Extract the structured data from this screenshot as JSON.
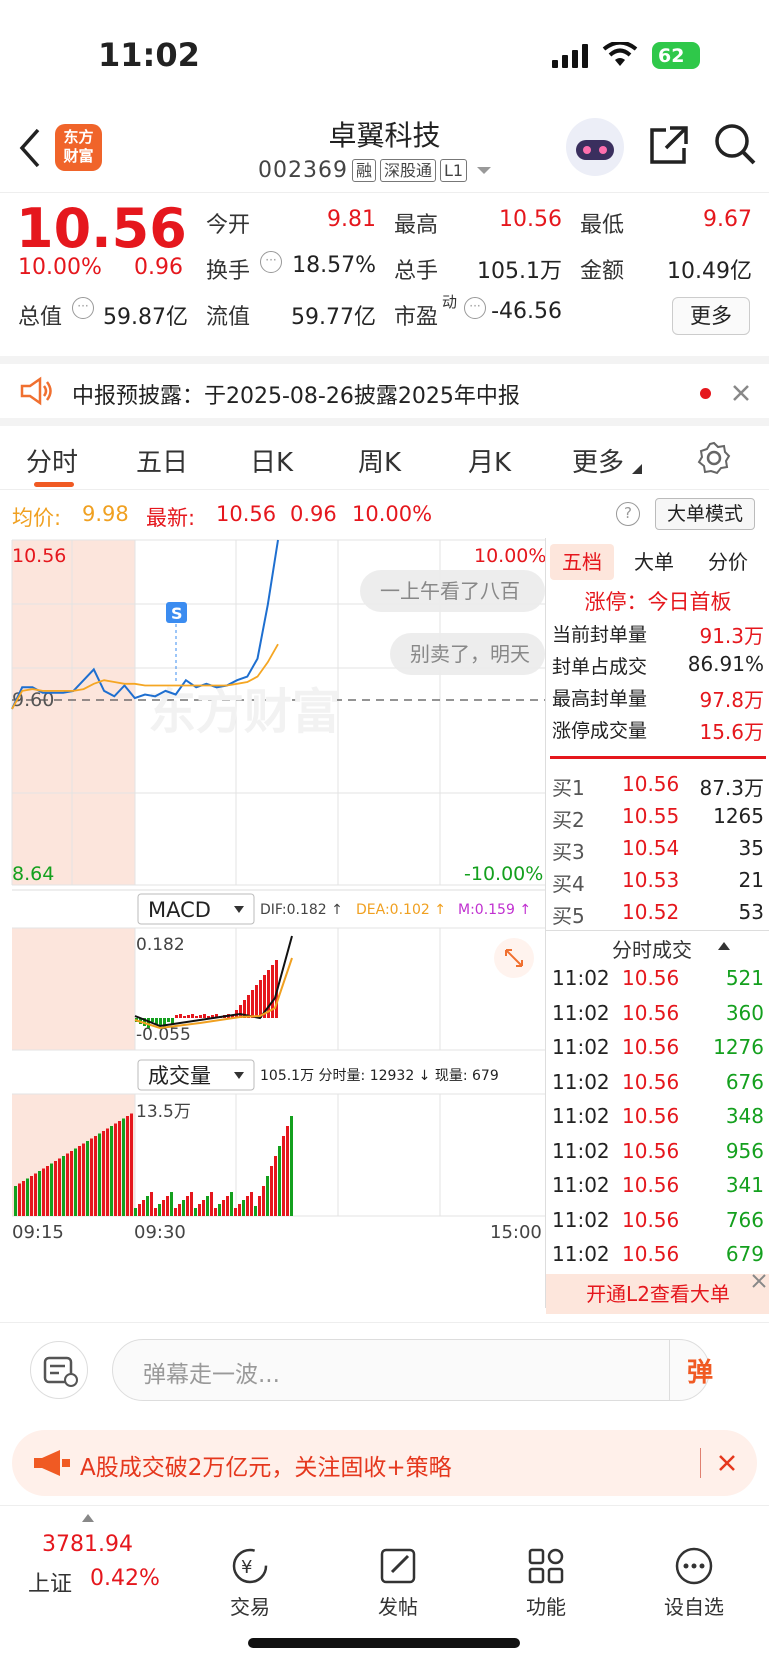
{
  "status": {
    "time": "11:02",
    "battery": "62"
  },
  "header": {
    "logo": "东方\n财富",
    "name": "卓翼科技",
    "code": "002369",
    "tags": [
      "融",
      "深股通",
      "L1"
    ]
  },
  "quote": {
    "price": "10.56",
    "change_pct": "10.00%",
    "change": "0.96",
    "open_label": "今开",
    "open": "9.81",
    "high_label": "最高",
    "high": "10.56",
    "low_label": "最低",
    "low": "9.67",
    "turnover_label": "换手",
    "turnover": "18.57%",
    "volume_label": "总手",
    "volume": "105.1万",
    "amount_label": "金额",
    "amount": "10.49亿",
    "mktcap_label": "总值",
    "mktcap": "59.87亿",
    "float_label": "流值",
    "float": "59.77亿",
    "pe_label": "市盈",
    "pe_sup": "动",
    "pe": "-46.56",
    "more": "更多"
  },
  "notice": {
    "text": "中报预披露：于2025-08-26披露2025年中报"
  },
  "tabs": [
    "分时",
    "五日",
    "日K",
    "周K",
    "月K",
    "更多"
  ],
  "info": {
    "avg_label": "均价:",
    "avg": "9.98",
    "latest_label": "最新:",
    "latest": "10.56",
    "chg": "0.96",
    "pct": "10.00%",
    "mode": "大单模式"
  },
  "chart_data": {
    "type": "line",
    "x": [
      "09:15",
      "09:30",
      "15:00"
    ],
    "y_left_top": "10.56",
    "y_left_mid": "9.60",
    "y_left_bottom": "8.64",
    "y_right_top": "10.00%",
    "y_right_bottom": "-10.00%",
    "ylim": [
      8.64,
      10.56
    ],
    "series": [
      {
        "name": "price",
        "color": "#1e6fd0",
        "values": [
          9.62,
          9.74,
          9.74,
          9.71,
          9.71,
          9.71,
          9.72,
          9.78,
          9.84,
          9.72,
          9.69,
          9.75,
          9.68,
          9.7,
          9.69,
          9.72,
          9.7,
          9.78,
          9.74,
          9.76,
          9.74,
          9.75,
          9.78,
          9.8,
          9.9,
          10.2,
          10.56
        ]
      },
      {
        "name": "avg",
        "color": "#f5a623",
        "values": [
          9.62,
          9.72,
          9.73,
          9.72,
          9.72,
          9.72,
          9.72,
          9.73,
          9.76,
          9.78,
          9.77,
          9.76,
          9.76,
          9.75,
          9.75,
          9.75,
          9.75,
          9.75,
          9.75,
          9.75,
          9.75,
          9.75,
          9.76,
          9.77,
          9.8,
          9.88,
          9.98
        ]
      }
    ],
    "danmaku": [
      "一上午看了八百",
      "别卖了，明天"
    ],
    "watermark": "东方财富",
    "s_marker": "S"
  },
  "macd": {
    "label": "MACD",
    "dif": "DIF:0.182 ↑",
    "dea": "DEA:0.102 ↑",
    "m": "M:0.159 ↑",
    "top": "0.182",
    "bottom": "-0.055"
  },
  "vol": {
    "label": "成交量",
    "stats": "105.1万 分时量: 12932 ↓ 现量: 679",
    "top": "13.5万"
  },
  "right": {
    "tabs": [
      "五档",
      "大单",
      "分价"
    ],
    "limit": "涨停：今日首板",
    "stats": [
      {
        "label": "当前封单量",
        "value": "91.3万"
      },
      {
        "label": "封单占成交",
        "value": "86.91%"
      },
      {
        "label": "最高封单量",
        "value": "97.8万"
      },
      {
        "label": "涨停成交量",
        "value": "15.6万"
      }
    ],
    "bids": [
      {
        "label": "买1",
        "price": "10.56",
        "vol": "87.3万"
      },
      {
        "label": "买2",
        "price": "10.55",
        "vol": "1265"
      },
      {
        "label": "买3",
        "price": "10.54",
        "vol": "35"
      },
      {
        "label": "买4",
        "price": "10.53",
        "vol": "21"
      },
      {
        "label": "买5",
        "price": "10.52",
        "vol": "53"
      }
    ],
    "ticks_title": "分时成交",
    "ticks": [
      {
        "t": "11:02",
        "p": "10.56",
        "v": "521"
      },
      {
        "t": "11:02",
        "p": "10.56",
        "v": "360"
      },
      {
        "t": "11:02",
        "p": "10.56",
        "v": "1276"
      },
      {
        "t": "11:02",
        "p": "10.56",
        "v": "676"
      },
      {
        "t": "11:02",
        "p": "10.56",
        "v": "348"
      },
      {
        "t": "11:02",
        "p": "10.56",
        "v": "956"
      },
      {
        "t": "11:02",
        "p": "10.56",
        "v": "341"
      },
      {
        "t": "11:02",
        "p": "10.56",
        "v": "766"
      },
      {
        "t": "11:02",
        "p": "10.56",
        "v": "679"
      }
    ],
    "l2": "开通L2查看大单"
  },
  "danmu": {
    "placeholder": "弹幕走一波...",
    "btn": "弹"
  },
  "ad": {
    "text": "A股成交破2万亿元，关注固收+策略"
  },
  "bottom": {
    "index_value": "3781.94",
    "index_name": "上证",
    "index_pct": "0.42%",
    "items": [
      "交易",
      "发帖",
      "功能",
      "设自选"
    ]
  }
}
